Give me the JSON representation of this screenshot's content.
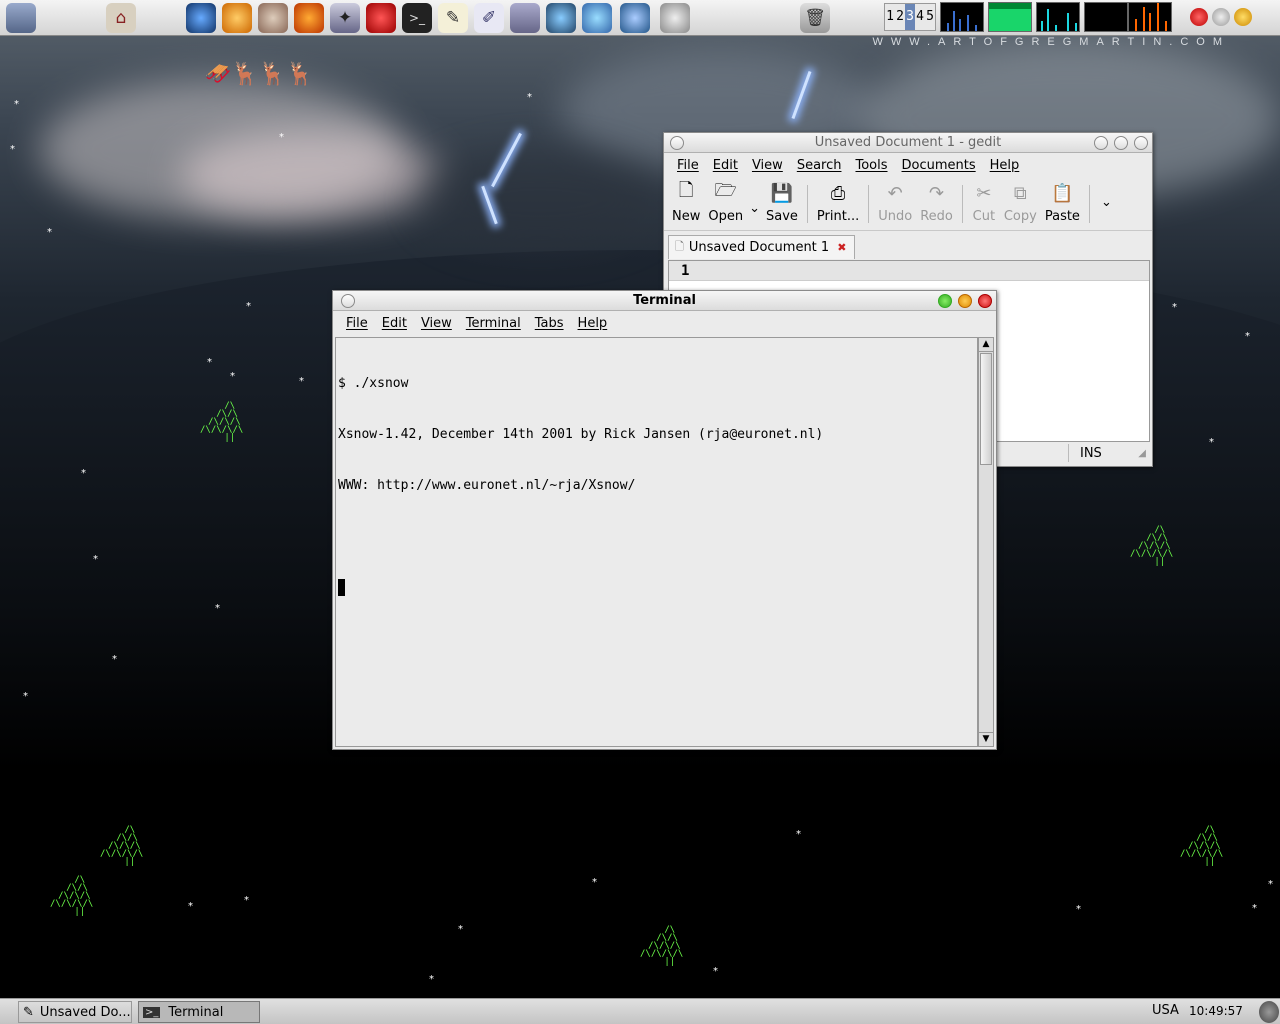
{
  "top_panel": {
    "launchers": [
      "apple-menu-icon",
      "home-icon",
      "web-browser-icon",
      "blender-icon",
      "gimp-icon",
      "firefox-icon",
      "tool-icon",
      "sticky-icon",
      "terminal-icon",
      "text-editor-icon",
      "draw-icon",
      "files-icon",
      "globe-mail-icon",
      "messenger-icon",
      "network-icon",
      "clock-icon",
      "trash-icon"
    ],
    "workspaces": [
      "1",
      "2",
      "3",
      "4",
      "5"
    ],
    "current_workspace": "3",
    "watermark": "WWW.ARTOFGREGMARTIN.COM"
  },
  "gedit": {
    "title": "Unsaved Document 1 - gedit",
    "menu": [
      "File",
      "Edit",
      "View",
      "Search",
      "Tools",
      "Documents",
      "Help"
    ],
    "toolbar": [
      {
        "label": "New",
        "icon": "new-document-icon",
        "enabled": true
      },
      {
        "label": "Open",
        "icon": "open-folder-icon",
        "enabled": true
      },
      {
        "label": "Save",
        "icon": "save-icon",
        "enabled": true
      },
      {
        "label": "Print...",
        "icon": "print-icon",
        "enabled": true
      },
      {
        "label": "Undo",
        "icon": "undo-icon",
        "enabled": false
      },
      {
        "label": "Redo",
        "icon": "redo-icon",
        "enabled": false
      },
      {
        "label": "Cut",
        "icon": "cut-icon",
        "enabled": false
      },
      {
        "label": "Copy",
        "icon": "copy-icon",
        "enabled": false
      },
      {
        "label": "Paste",
        "icon": "paste-icon",
        "enabled": true
      }
    ],
    "tab_label": "Unsaved Document 1",
    "line_number": "1",
    "status_mode": "INS"
  },
  "terminal": {
    "title": "Terminal",
    "menu": [
      "File",
      "Edit",
      "View",
      "Terminal",
      "Tabs",
      "Help"
    ],
    "lines": [
      "$ ./xsnow",
      "Xsnow-1.42, December 14th 2001 by Rick Jansen (rja@euronet.nl)",
      "WWW: http://www.euronet.nl/~rja/Xsnow/"
    ]
  },
  "taskbar": {
    "tasks": [
      {
        "label": "Unsaved Do...",
        "icon": "gedit-icon"
      },
      {
        "label": "Terminal",
        "icon": "terminal-icon"
      }
    ],
    "keyboard_layout": "USA",
    "clock": "10:49:57"
  }
}
